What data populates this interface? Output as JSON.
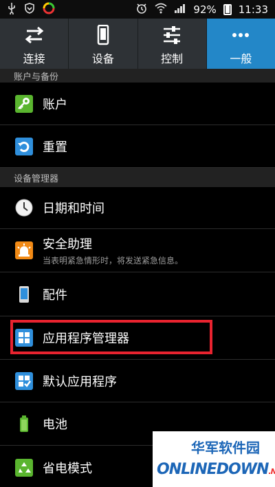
{
  "status_bar": {
    "battery_percent": "92%",
    "time": "11:33",
    "icons": [
      "usb-icon",
      "shield-icon",
      "app-icon",
      "alarm-icon",
      "wifi-icon",
      "signal-icon",
      "battery-icon"
    ]
  },
  "tabs": [
    {
      "label": "连接",
      "icon": "swap-arrows-icon",
      "active": false
    },
    {
      "label": "设备",
      "icon": "phone-icon",
      "active": false
    },
    {
      "label": "控制",
      "icon": "sliders-icon",
      "active": false
    },
    {
      "label": "一般",
      "icon": "more-dots-icon",
      "active": true
    }
  ],
  "sections": {
    "account_backup": "账户与备份",
    "device_manager": "设备管理器"
  },
  "items": {
    "account": {
      "title": "账户",
      "icon": "key-icon"
    },
    "reset": {
      "title": "重置",
      "icon": "reset-icon"
    },
    "datetime": {
      "title": "日期和时间",
      "icon": "clock-icon"
    },
    "safety": {
      "title": "安全助理",
      "subtitle": "当表明紧急情形时，将发送紧急信息。",
      "icon": "alarm-light-icon"
    },
    "accessories": {
      "title": "配件",
      "icon": "device-icon"
    },
    "app_manager": {
      "title": "应用程序管理器",
      "icon": "grid-icon"
    },
    "default_apps": {
      "title": "默认应用程序",
      "icon": "grid-check-icon"
    },
    "battery": {
      "title": "电池",
      "icon": "battery-icon"
    },
    "power_saving": {
      "title": "省电模式",
      "icon": "recycle-icon"
    }
  },
  "watermark": {
    "cn": "华军软件园",
    "en_main": "NLINEDOWN",
    "en_prefix": "O",
    "en_suffix": ".NET"
  },
  "colors": {
    "active_tab": "#2387c8",
    "highlight": "#e8232f",
    "watermark_blue": "#1c66b7"
  }
}
